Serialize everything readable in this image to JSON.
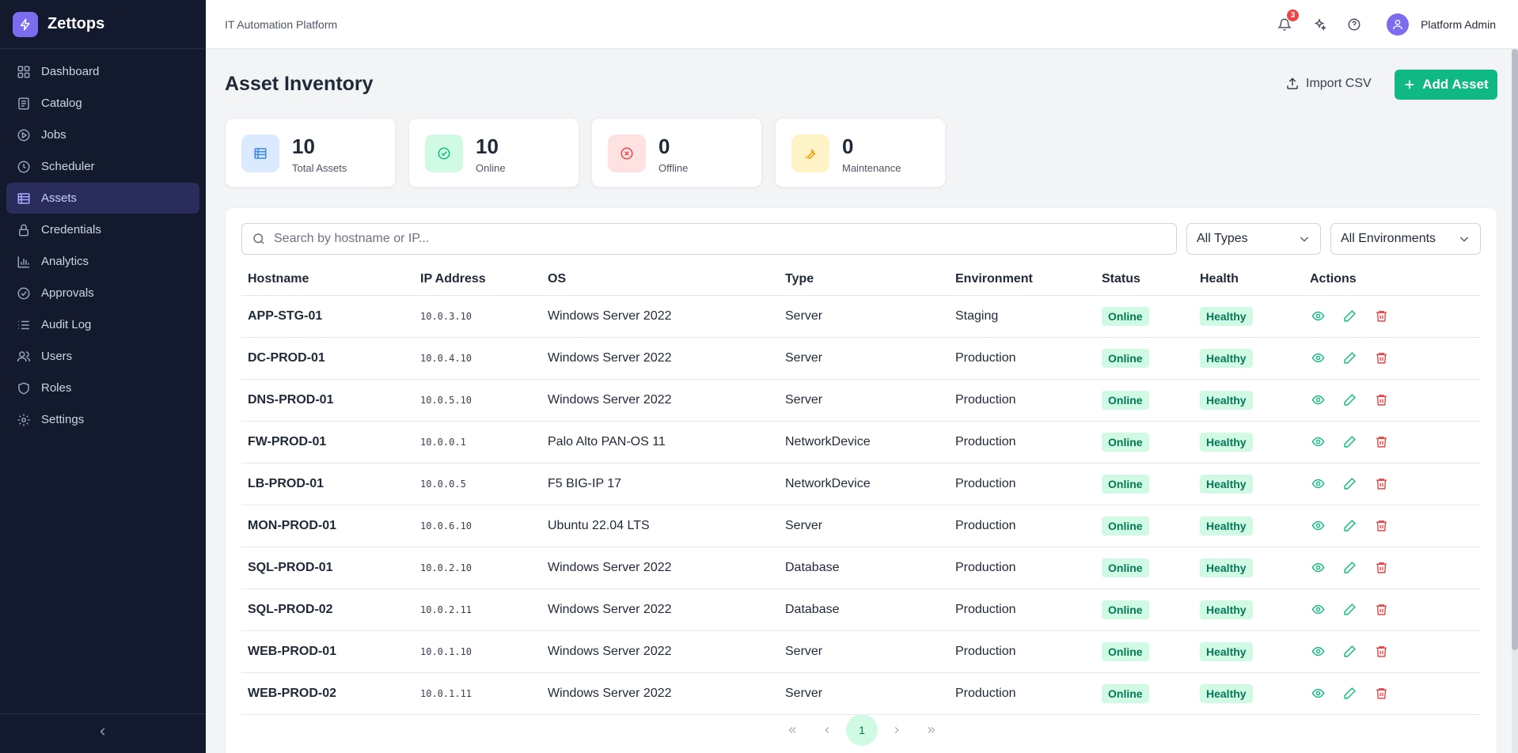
{
  "brand": {
    "name": "Zettops"
  },
  "sidebar": {
    "items": [
      {
        "label": "Dashboard",
        "icon": "grid-icon",
        "active": false
      },
      {
        "label": "Catalog",
        "icon": "book-icon",
        "active": false
      },
      {
        "label": "Jobs",
        "icon": "play-circle-icon",
        "active": false
      },
      {
        "label": "Scheduler",
        "icon": "clock-icon",
        "active": false
      },
      {
        "label": "Assets",
        "icon": "server-icon",
        "active": true
      },
      {
        "label": "Credentials",
        "icon": "lock-icon",
        "active": false
      },
      {
        "label": "Analytics",
        "icon": "bar-chart-icon",
        "active": false
      },
      {
        "label": "Approvals",
        "icon": "check-circle-icon",
        "active": false
      },
      {
        "label": "Audit Log",
        "icon": "list-icon",
        "active": false
      },
      {
        "label": "Users",
        "icon": "users-icon",
        "active": false
      },
      {
        "label": "Roles",
        "icon": "shield-icon",
        "active": false
      },
      {
        "label": "Settings",
        "icon": "gear-icon",
        "active": false
      }
    ],
    "collapse_icon": "chevron-left-icon"
  },
  "topbar": {
    "title": "IT Automation Platform",
    "notification_count": "3",
    "user_name": "Platform Admin"
  },
  "page": {
    "title": "Asset Inventory",
    "import_label": "Import CSV",
    "add_label": "Add Asset"
  },
  "stats": [
    {
      "value": "10",
      "label": "Total Assets",
      "icon": "server-icon",
      "color": "#3b82f6"
    },
    {
      "value": "10",
      "label": "Online",
      "icon": "check-circle-icon",
      "color": "#10b981"
    },
    {
      "value": "0",
      "label": "Offline",
      "icon": "x-circle-icon",
      "color": "#ef4444"
    },
    {
      "value": "0",
      "label": "Maintenance",
      "icon": "wrench-icon",
      "color": "#f59e0b"
    }
  ],
  "filters": {
    "search_placeholder": "Search by hostname or IP...",
    "type_value": "All Types",
    "env_value": "All Environments"
  },
  "table": {
    "columns": [
      "Hostname",
      "IP Address",
      "OS",
      "Type",
      "Environment",
      "Status",
      "Health",
      "Actions"
    ],
    "rows": [
      {
        "hostname": "APP-STG-01",
        "ip": "10.0.3.10",
        "os": "Windows Server 2022",
        "type": "Server",
        "environment": "Staging",
        "status": "Online",
        "health": "Healthy"
      },
      {
        "hostname": "DC-PROD-01",
        "ip": "10.0.4.10",
        "os": "Windows Server 2022",
        "type": "Server",
        "environment": "Production",
        "status": "Online",
        "health": "Healthy"
      },
      {
        "hostname": "DNS-PROD-01",
        "ip": "10.0.5.10",
        "os": "Windows Server 2022",
        "type": "Server",
        "environment": "Production",
        "status": "Online",
        "health": "Healthy"
      },
      {
        "hostname": "FW-PROD-01",
        "ip": "10.0.0.1",
        "os": "Palo Alto PAN-OS 11",
        "type": "NetworkDevice",
        "environment": "Production",
        "status": "Online",
        "health": "Healthy"
      },
      {
        "hostname": "LB-PROD-01",
        "ip": "10.0.0.5",
        "os": "F5 BIG-IP 17",
        "type": "NetworkDevice",
        "environment": "Production",
        "status": "Online",
        "health": "Healthy"
      },
      {
        "hostname": "MON-PROD-01",
        "ip": "10.0.6.10",
        "os": "Ubuntu 22.04 LTS",
        "type": "Server",
        "environment": "Production",
        "status": "Online",
        "health": "Healthy"
      },
      {
        "hostname": "SQL-PROD-01",
        "ip": "10.0.2.10",
        "os": "Windows Server 2022",
        "type": "Database",
        "environment": "Production",
        "status": "Online",
        "health": "Healthy"
      },
      {
        "hostname": "SQL-PROD-02",
        "ip": "10.0.2.11",
        "os": "Windows Server 2022",
        "type": "Database",
        "environment": "Production",
        "status": "Online",
        "health": "Healthy"
      },
      {
        "hostname": "WEB-PROD-01",
        "ip": "10.0.1.10",
        "os": "Windows Server 2022",
        "type": "Server",
        "environment": "Production",
        "status": "Online",
        "health": "Healthy"
      },
      {
        "hostname": "WEB-PROD-02",
        "ip": "10.0.1.11",
        "os": "Windows Server 2022",
        "type": "Server",
        "environment": "Production",
        "status": "Online",
        "health": "Healthy"
      }
    ],
    "action_icons": [
      "eye-icon",
      "pencil-icon",
      "trash-icon"
    ]
  },
  "pagination": {
    "current_page": "1",
    "controls": [
      "first-page-icon",
      "prev-page-icon",
      "next-page-icon",
      "last-page-icon"
    ]
  },
  "colors": {
    "sidebar_bg": "#141a2e",
    "active_item_bg": "#2a2d5c",
    "accent_green": "#10b981",
    "brand_purple": "#7c6cf0",
    "badge_green_bg": "#d1fae5",
    "badge_green_text": "#047857"
  }
}
